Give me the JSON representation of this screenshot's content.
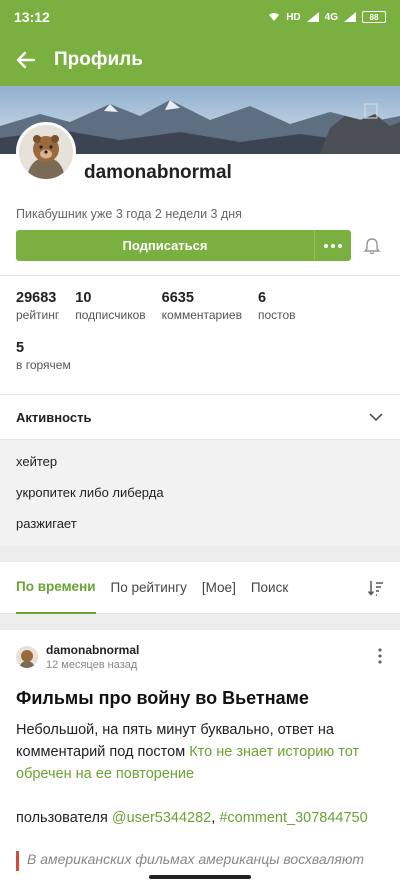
{
  "status_bar": {
    "time": "13:12",
    "battery": "88",
    "net1": "HD",
    "net2": "4G"
  },
  "app_bar": {
    "title": "Профиль"
  },
  "profile": {
    "username": "damonabnormal",
    "since": "Пикабушник уже 3 года 2 недели 3 дня",
    "subscribe_label": "Подписаться"
  },
  "stats": [
    {
      "value": "29683",
      "label": "рейтинг"
    },
    {
      "value": "10",
      "label": "подписчиков"
    },
    {
      "value": "6635",
      "label": "комментариев"
    },
    {
      "value": "6",
      "label": "постов"
    },
    {
      "value": "5",
      "label": "в горячем"
    }
  ],
  "activity": {
    "title": "Активность"
  },
  "tags": [
    "хейтер",
    "укропитек либо либерда",
    "разжигает"
  ],
  "sort_tabs": [
    "По времени",
    "По рейтингу",
    "[Мое]",
    "Поиск"
  ],
  "post": {
    "author": "damonabnormal",
    "time": "12 месяцев назад",
    "title": "Фильмы про войну во Вьетнаме",
    "body_text": "Небольшой, на пять минут буквально, ответ на комментарий под постом ",
    "body_link": "Кто не знает историю тот обречен на ее повторение",
    "user_prefix": "пользователя ",
    "user_link": "@user5344282",
    "comma": ", ",
    "comment_link": "#comment_307844750",
    "quote": "В американских фильмах американцы восхваляют"
  },
  "colors": {
    "accent": "#7ab03f",
    "link": "#6aa233",
    "quote_bar": "#d64a3b"
  }
}
